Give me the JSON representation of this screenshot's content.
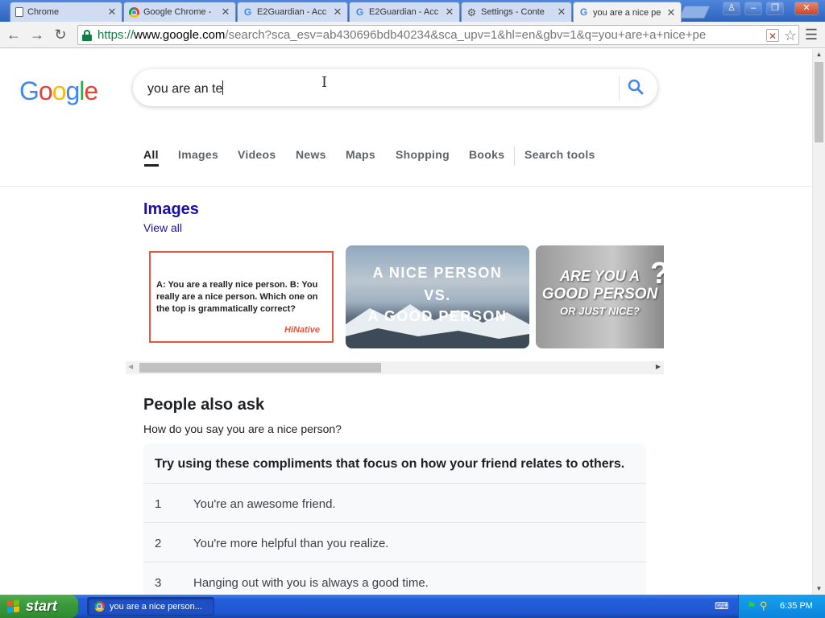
{
  "browser": {
    "tabs": [
      {
        "title": "Chrome",
        "icon": "page-icon"
      },
      {
        "title": "Google Chrome - ",
        "icon": "chrome-icon"
      },
      {
        "title": "E2Guardian - Acc",
        "icon": "google-g-icon"
      },
      {
        "title": "E2Guardian - Acc",
        "icon": "google-g-icon"
      },
      {
        "title": "Settings - Conte",
        "icon": "gear-icon"
      },
      {
        "title": "you are a nice pe",
        "icon": "google-g-icon",
        "active": true
      }
    ],
    "address": {
      "scheme": "https://",
      "host": "www.google.com",
      "rest": "/search?sca_esv=ab430696bdb40234&sca_upv=1&hl=en&gbv=1&q=you+are+a+nice+pe"
    }
  },
  "search": {
    "query": "you are an te"
  },
  "nav_tabs": [
    "All",
    "Images",
    "Videos",
    "News",
    "Maps",
    "Shopping",
    "Books",
    "Search tools"
  ],
  "images_section": {
    "heading": "Images",
    "view_all": "View all",
    "cards": [
      {
        "text": "A: You are a really nice person. B: You really are a nice person. Which one on the top is grammatically correct?",
        "brand": "HiNative"
      },
      {
        "line1": "A NICE PERSON",
        "line2": "VS.",
        "line3": "A GOOD PERSON"
      },
      {
        "line1": "ARE YOU A",
        "line2": "GOOD PERSON",
        "line3": "OR JUST NICE?",
        "mark": "?"
      }
    ]
  },
  "people_also_ask": {
    "heading": "People also ask",
    "question": "How do you say you are a nice person?",
    "answer_heading": "Try using these compliments that focus on how your friend relates to others.",
    "items": [
      {
        "num": "1",
        "text": "You're an awesome friend."
      },
      {
        "num": "2",
        "text": "You're more helpful than you realize."
      },
      {
        "num": "3",
        "text": "Hanging out with you is always a good time."
      }
    ]
  },
  "taskbar": {
    "start_label": "start",
    "task_title": "you are a nice person...",
    "clock": "6:35 PM"
  },
  "colors": {
    "link": "#1a0dab",
    "google_blue": "#4285f4",
    "google_red": "#ea4335",
    "google_yellow": "#fbbc05",
    "google_green": "#34a853"
  }
}
